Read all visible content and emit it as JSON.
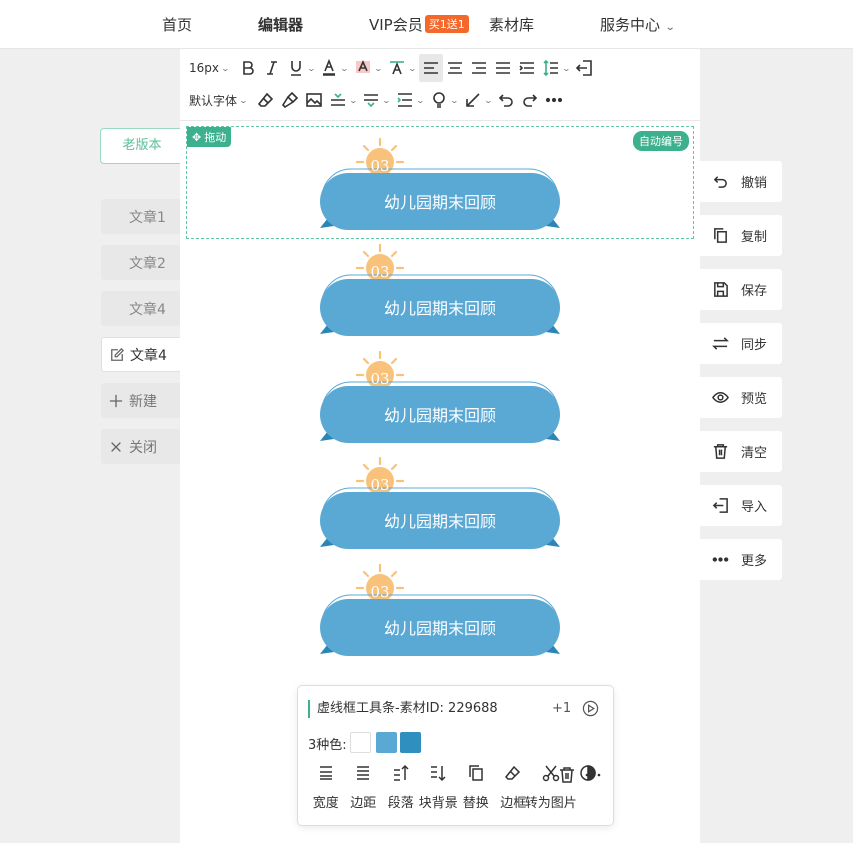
{
  "nav": {
    "home": "首页",
    "editor": "编辑器",
    "vip": "VIP会员",
    "vip_badge": "买1送1",
    "materials": "素材库",
    "service": "服务中心"
  },
  "toolbar": {
    "font_size": "16px",
    "font_family": "默认字体"
  },
  "selection": {
    "drag_label": "拖动",
    "auto_number_label": "自动编号"
  },
  "title_blocks": [
    {
      "number": "03",
      "text": "幼儿园期末回顾"
    },
    {
      "number": "03",
      "text": "幼儿园期末回顾"
    },
    {
      "number": "03",
      "text": "幼儿园期末回顾"
    },
    {
      "number": "03",
      "text": "幼儿园期末回顾"
    },
    {
      "number": "03",
      "text": "幼儿园期末回顾"
    }
  ],
  "left_panel": {
    "old_version": "老版本",
    "articles": [
      "文章1",
      "文章2",
      "文章4"
    ],
    "current_article": "文章4",
    "new_label": "新建",
    "close_label": "关闭"
  },
  "right_panel": {
    "undo": "撤销",
    "copy": "复制",
    "save": "保存",
    "sync": "同步",
    "preview": "预览",
    "clear": "清空",
    "import": "导入",
    "more": "更多"
  },
  "popup": {
    "title": "虚线框工具条-素材ID: 229688",
    "plus": "+1",
    "colors_label": "3种色:",
    "colors": [
      "#ffffff",
      "#5aa8d4",
      "#2f8fbe"
    ],
    "tools": [
      "宽度",
      "边距",
      "段落",
      "块背景",
      "替换",
      "边框",
      "转为图片"
    ]
  },
  "colors": {
    "accent": "#3db08d",
    "title_blue": "#5aa8d4",
    "ribbon_blue": "#2b86b7",
    "sun_orange": "#f9c27a",
    "vip_orange": "#f4692b"
  }
}
